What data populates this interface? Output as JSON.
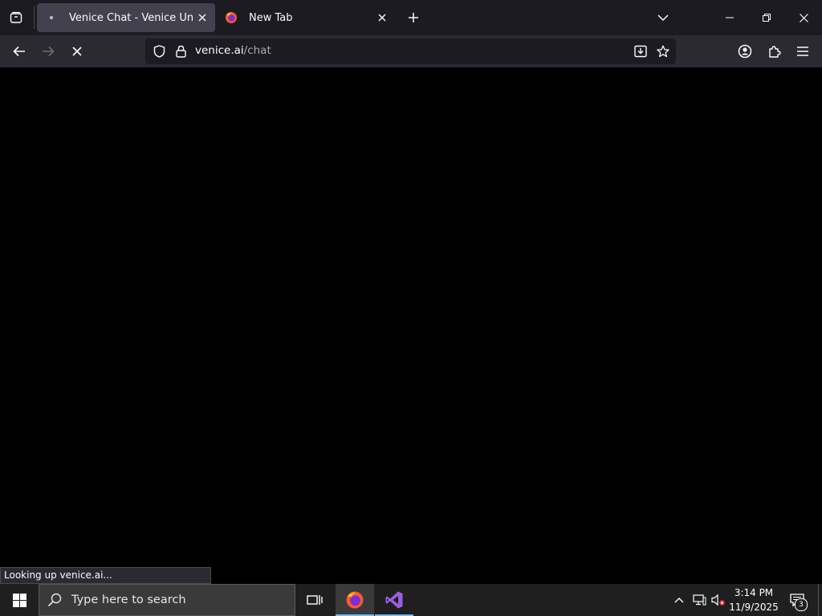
{
  "browser": {
    "tabs": [
      {
        "title": "Venice Chat - Venice Uncensored",
        "active": true
      },
      {
        "title": "New Tab",
        "active": false
      }
    ],
    "url": {
      "host": "venice.ai",
      "path": "/chat"
    },
    "status_text": "Looking up venice.ai..."
  },
  "taskbar": {
    "search_placeholder": "Type here to search",
    "time": "3:14 PM",
    "date": "11/9/2025",
    "notification_count": "3"
  },
  "colors": {
    "tabstrip_bg": "#1c1b22",
    "navbar_bg": "#2b2a33",
    "active_tab_bg": "#42414d",
    "taskbar_bg": "#1f1f1f",
    "vs_purple": "#9b5fe0"
  }
}
